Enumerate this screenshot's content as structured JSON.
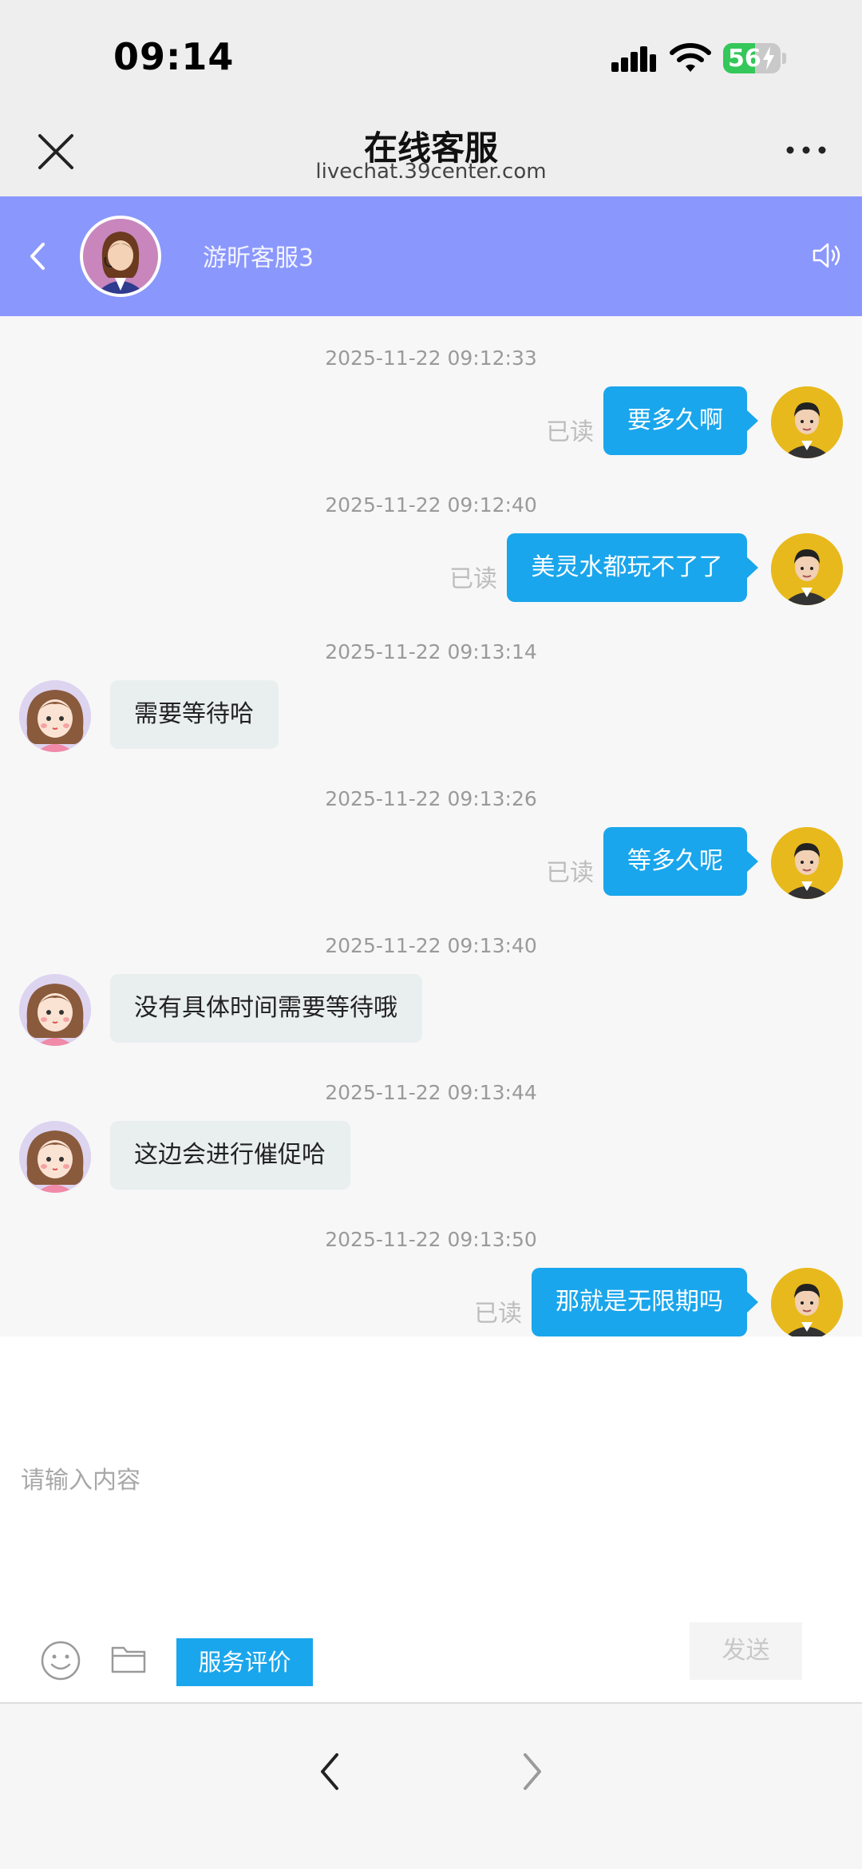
{
  "status_bar": {
    "time": "09:14",
    "battery": "56",
    "battery_level": 0.56,
    "icons": [
      "signal-icon",
      "wifi-icon",
      "battery-charging-icon"
    ]
  },
  "browser": {
    "title": "在线客服",
    "url": "livechat.39center.com",
    "icons": [
      "close-icon",
      "more-icon"
    ]
  },
  "chat_header": {
    "agent_name": "游昕客服3",
    "icons": [
      "back-chevron-icon",
      "speaker-icon"
    ]
  },
  "messages": [
    {
      "time": "2025-11-22 09:12:33",
      "sender": "me",
      "text": "要多久啊",
      "read": "已读"
    },
    {
      "time": "2025-11-22 09:12:40",
      "sender": "me",
      "text": "美灵水都玩不了了",
      "read": "已读"
    },
    {
      "time": "2025-11-22 09:13:14",
      "sender": "agent",
      "text": "需要等待哈"
    },
    {
      "time": "2025-11-22 09:13:26",
      "sender": "me",
      "text": "等多久呢",
      "read": "已读"
    },
    {
      "time": "2025-11-22 09:13:40",
      "sender": "agent",
      "text": "没有具体时间需要等待哦"
    },
    {
      "time": "2025-11-22 09:13:44",
      "sender": "agent",
      "text": "这边会进行催促哈"
    },
    {
      "time": "2025-11-22 09:13:50",
      "sender": "me",
      "text": "那就是无限期吗",
      "read": "已读"
    }
  ],
  "composer": {
    "placeholder": "请输入内容",
    "rate_label": "服务评价",
    "send_label": "发送",
    "icons": [
      "emoji-icon",
      "folder-icon"
    ]
  },
  "colors": {
    "header_bg": "#8a97fd",
    "my_bubble": "#1aa6ec",
    "agent_bubble": "#e9eeee",
    "battery_green": "#34c759"
  }
}
